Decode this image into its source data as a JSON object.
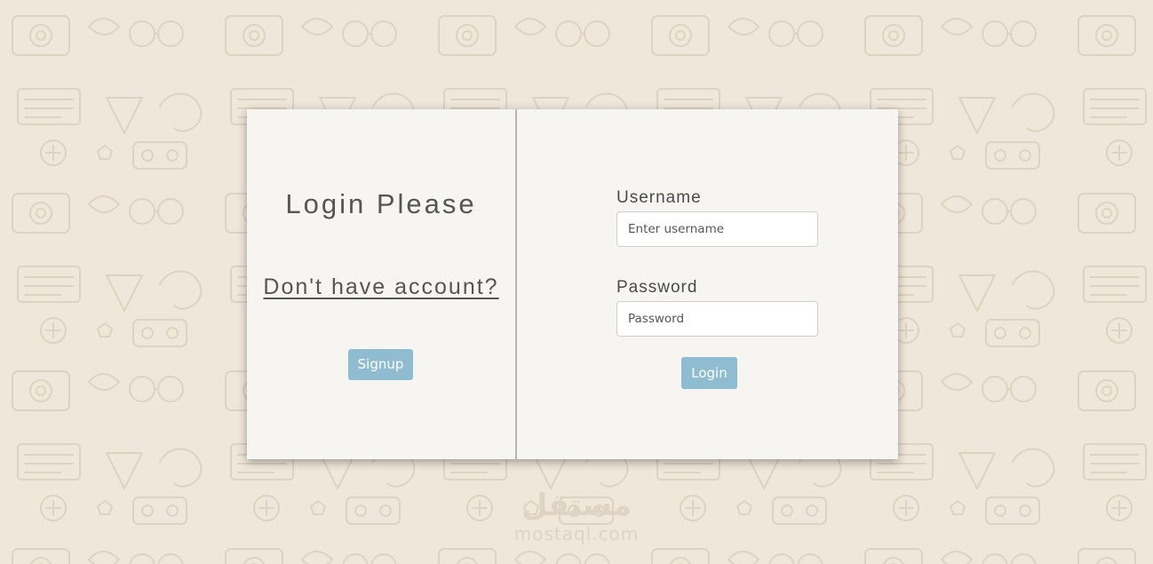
{
  "login_panel": {
    "heading": "Login Please",
    "signup_prompt": "Don't have account?",
    "signup_button": "Signup"
  },
  "form": {
    "username_label": "Username",
    "username_placeholder": "Enter username",
    "password_label": "Password",
    "password_placeholder": "Password",
    "login_button": "Login"
  },
  "watermark": {
    "arabic": "مستقل",
    "latin": "mostaql.com"
  },
  "colors": {
    "background": "#efe7d9",
    "card": "#f6f5f1",
    "button": "#8fbcd0",
    "text": "#555555"
  }
}
